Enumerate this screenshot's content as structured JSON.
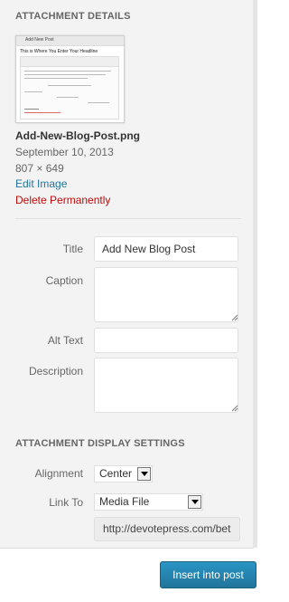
{
  "details": {
    "heading": "Attachment Details",
    "thumb": {
      "window_caption": "Add New Post",
      "title_text": "This is Where You Enter Your Headline"
    },
    "filename": "Add-New-Blog-Post.png",
    "date": "September 10, 2013",
    "dimensions": "807 × 649",
    "edit_link": "Edit Image",
    "delete_link": "Delete Permanently"
  },
  "fields": {
    "title_label": "Title",
    "title_value": "Add New Blog Post",
    "caption_label": "Caption",
    "caption_value": "",
    "alt_label": "Alt Text",
    "alt_value": "",
    "description_label": "Description",
    "description_value": ""
  },
  "display_settings": {
    "heading": "Attachment Display Settings",
    "alignment_label": "Alignment",
    "alignment_value": "Center",
    "link_to_label": "Link To",
    "link_to_value": "Media File",
    "url_value": "http://devotepress.com/bet"
  },
  "footer": {
    "insert_label": "Insert into post"
  },
  "colors": {
    "link": "#21759b",
    "delete": "#bc0b0b",
    "primary_button": "#21759b"
  }
}
